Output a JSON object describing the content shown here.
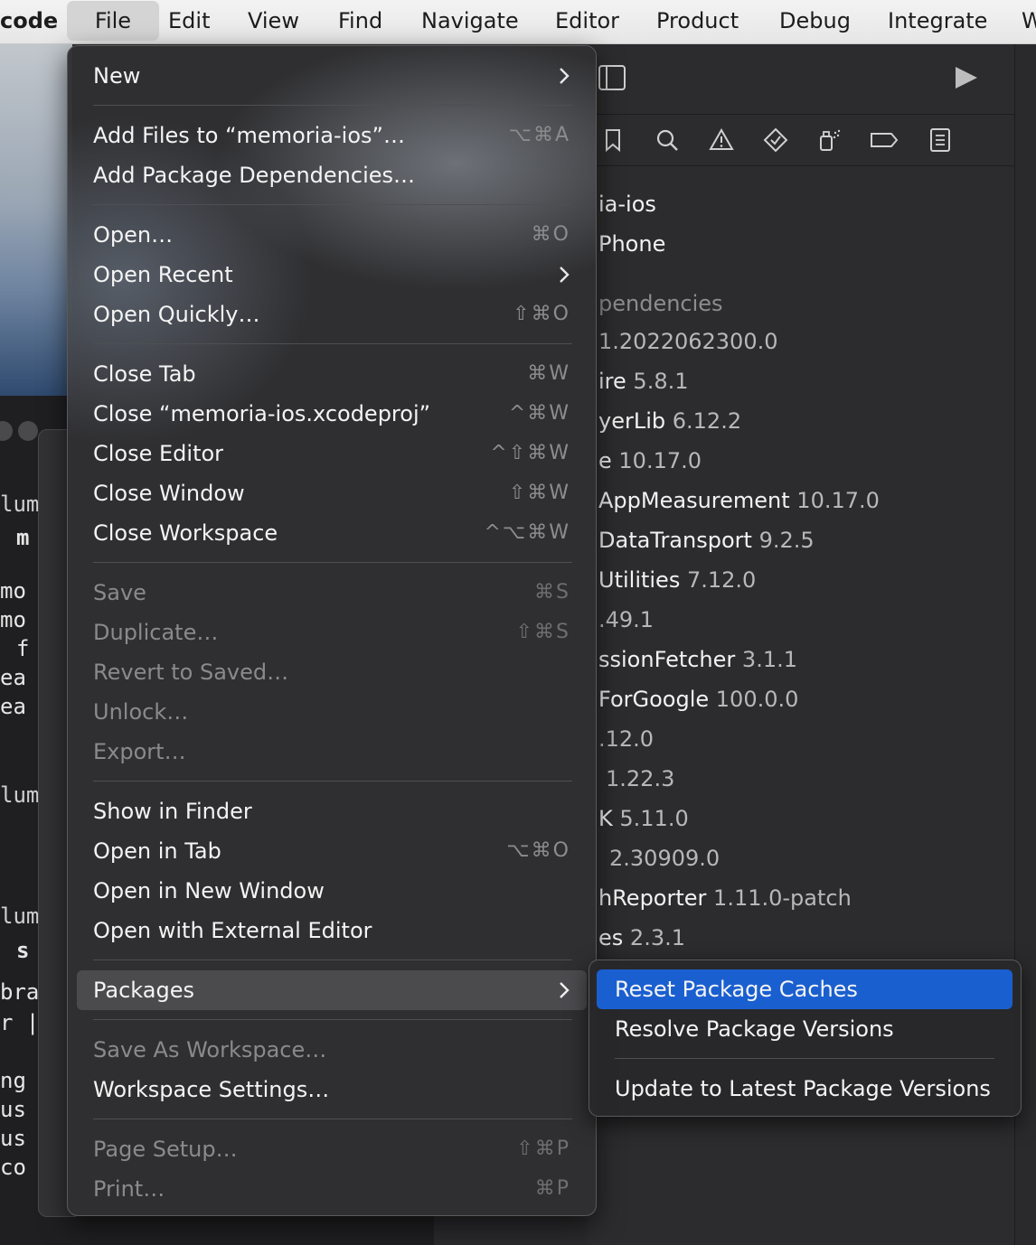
{
  "menubar": {
    "app": "code",
    "items": [
      "File",
      "Edit",
      "View",
      "Find",
      "Navigate",
      "Editor",
      "Product",
      "Debug",
      "Integrate",
      "W"
    ]
  },
  "background": {
    "code_fragments": [
      "lum",
      "m",
      "mo",
      "mo",
      "f",
      "ea",
      "ea",
      "lum",
      "lum",
      "s",
      "bra",
      "r |",
      "ng",
      "us",
      "us",
      "co"
    ],
    "dependencies_header": "pendencies",
    "dependencies": [
      {
        "name": "ia-ios",
        "version": ""
      },
      {
        "name": "Phone",
        "version": ""
      },
      {
        "name": "",
        "version": "1.2022062300.0"
      },
      {
        "name": "ire",
        "version": "5.8.1"
      },
      {
        "name": "yerLib",
        "version": "6.12.2"
      },
      {
        "name": "e",
        "version": "10.17.0"
      },
      {
        "name": "AppMeasurement",
        "version": "10.17.0"
      },
      {
        "name": "DataTransport",
        "version": "9.2.5"
      },
      {
        "name": "Utilities",
        "version": "7.12.0"
      },
      {
        "name": "",
        "version": ".49.1"
      },
      {
        "name": "ssionFetcher",
        "version": "3.1.1"
      },
      {
        "name": "ForGoogle",
        "version": "100.0.0"
      },
      {
        "name": "",
        "version": ".12.0"
      },
      {
        "name": "",
        "version": "1.22.3"
      },
      {
        "name": "K",
        "version": "5.11.0"
      },
      {
        "name": "",
        "version": "2.30909.0"
      },
      {
        "name": "hReporter",
        "version": "1.11.0-patch"
      },
      {
        "name": "es",
        "version": "2.3.1"
      }
    ]
  },
  "file_menu": {
    "new": "New",
    "add_files": "Add Files to “memoria-ios”…",
    "add_files_sc": "⌥⌘A",
    "add_packages": "Add Package Dependencies…",
    "open": "Open…",
    "open_sc": "⌘O",
    "open_recent": "Open Recent",
    "open_quickly": "Open Quickly…",
    "open_quickly_sc": "⇧⌘O",
    "close_tab": "Close Tab",
    "close_tab_sc": "⌘W",
    "close_project": "Close “memoria-ios.xcodeproj”",
    "close_project_sc": "^⌘W",
    "close_editor": "Close Editor",
    "close_editor_sc": "^⇧⌘W",
    "close_window": "Close Window",
    "close_window_sc": "⇧⌘W",
    "close_workspace": "Close Workspace",
    "close_workspace_sc": "^⌥⌘W",
    "save": "Save",
    "save_sc": "⌘S",
    "duplicate": "Duplicate…",
    "duplicate_sc": "⇧⌘S",
    "revert": "Revert to Saved…",
    "unlock": "Unlock…",
    "export": "Export…",
    "show_in_finder": "Show in Finder",
    "open_in_tab": "Open in Tab",
    "open_in_tab_sc": "⌥⌘O",
    "open_new_window": "Open in New Window",
    "open_external": "Open with External Editor",
    "packages": "Packages",
    "save_as_workspace": "Save As Workspace…",
    "workspace_settings": "Workspace Settings…",
    "page_setup": "Page Setup…",
    "page_setup_sc": "⇧⌘P",
    "print": "Print…",
    "print_sc": "⌘P"
  },
  "packages_menu": {
    "reset": "Reset Package Caches",
    "resolve": "Resolve Package Versions",
    "update": "Update to Latest Package Versions"
  },
  "colors": {
    "selection": "#1a5fd0",
    "menu_bg": "#303032",
    "menubar_bg": "#ececec"
  }
}
